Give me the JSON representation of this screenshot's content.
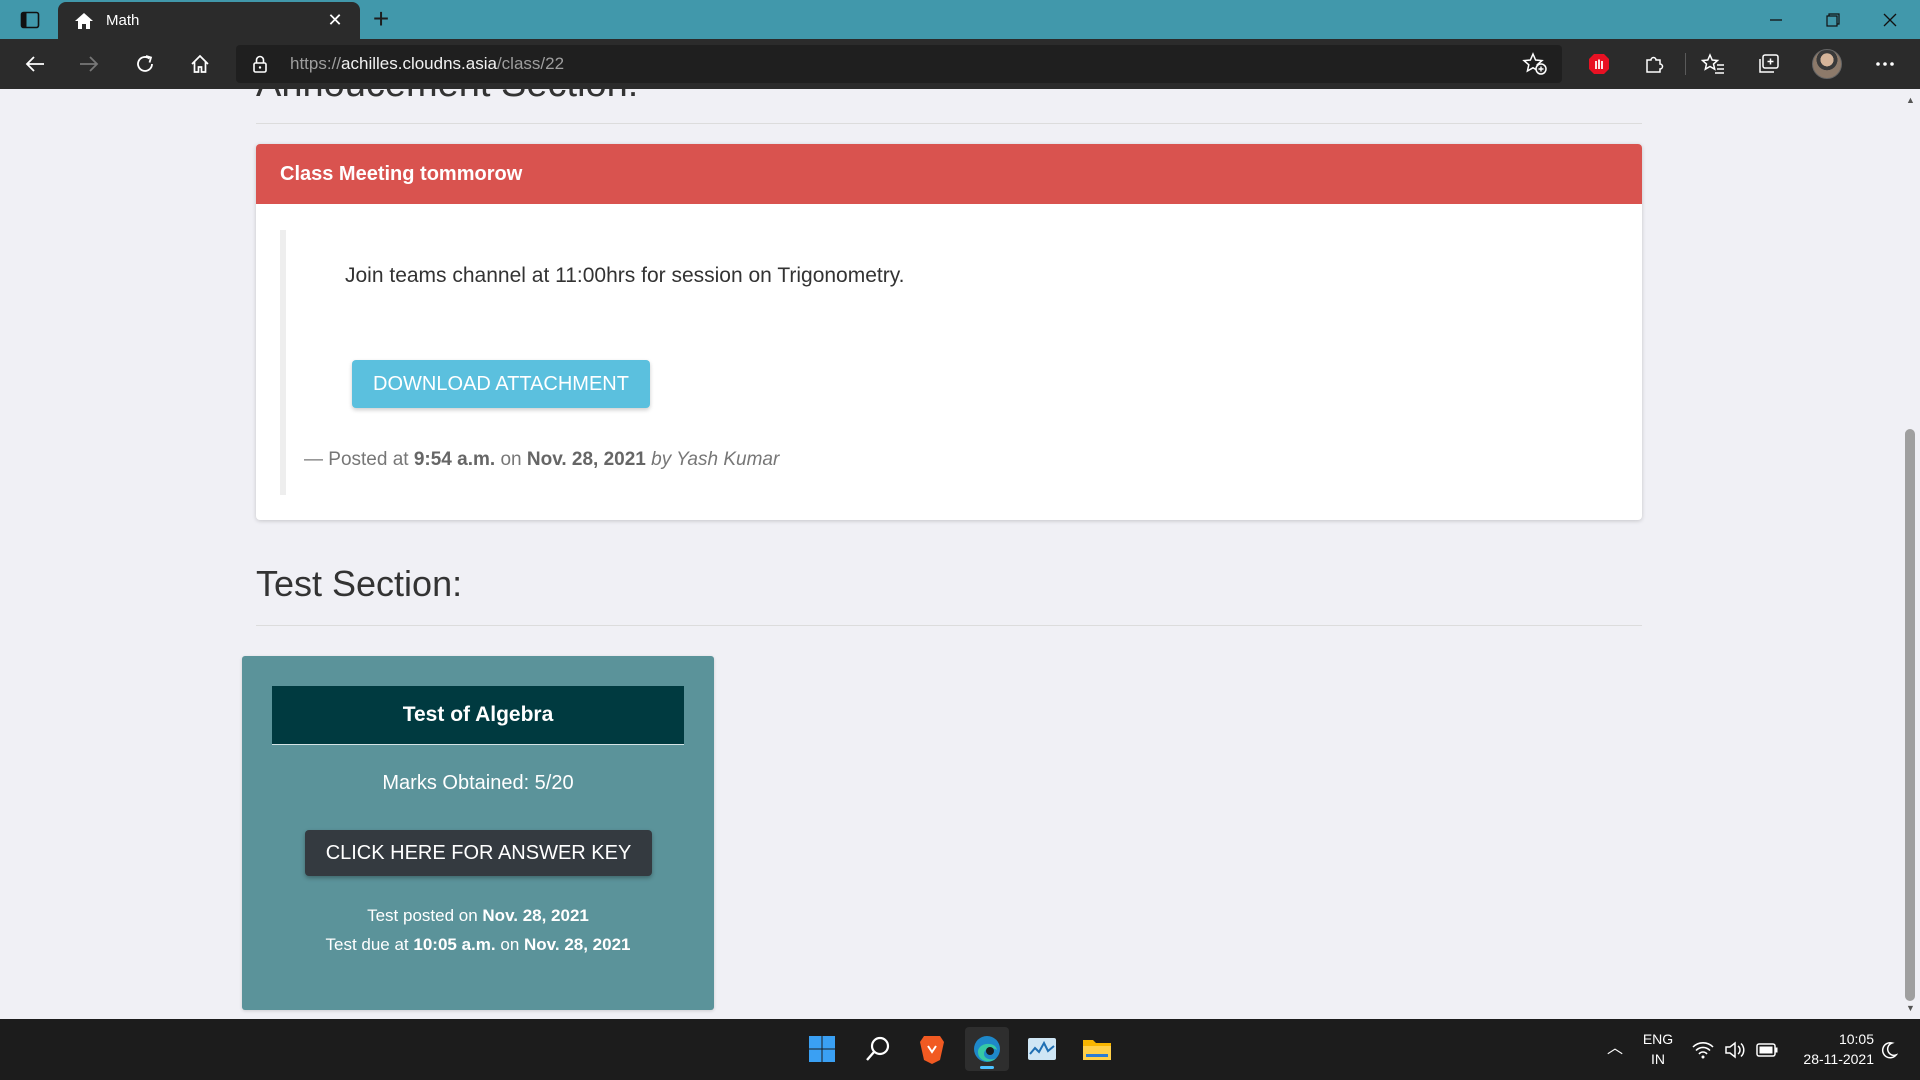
{
  "browser": {
    "tab_title": "Math",
    "url_scheme": "https://",
    "url_host": "achilles.cloudns.asia",
    "url_path": "/class/22"
  },
  "announcement_section": {
    "heading": "Annoucement Section:",
    "card": {
      "title": "Class Meeting tommorow",
      "text": "Join teams channel at 11:00hrs for session on Trigonometry.",
      "download_label": "DOWNLOAD ATTACHMENT",
      "posted_prefix": "— Posted at",
      "posted_time": "9:54 a.m.",
      "posted_on": "on",
      "posted_date": "Nov. 28, 2021",
      "posted_by": "by Yash Kumar"
    }
  },
  "test_section": {
    "heading": "Test Section:",
    "card": {
      "title": "Test of Algebra",
      "marks": "Marks Obtained: 5/20",
      "answer_key_label": "CLICK HERE FOR ANSWER KEY",
      "posted_prefix": "Test posted on",
      "posted_date": "Nov. 28, 2021",
      "due_prefix": "Test due at",
      "due_time": "10:05 a.m.",
      "due_on": "on",
      "due_date": "Nov. 28, 2021"
    }
  },
  "taskbar": {
    "language_line1": "ENG",
    "language_line2": "IN",
    "time": "10:05",
    "date": "28-11-2021"
  },
  "colors": {
    "titlebar": "#4198ab",
    "toolbar": "#2b2b2b",
    "danger_header": "#d9534f",
    "info_button": "#5bc0de",
    "test_card": "#5b939a",
    "test_title": "#003a40",
    "dark_button": "#343a40"
  }
}
